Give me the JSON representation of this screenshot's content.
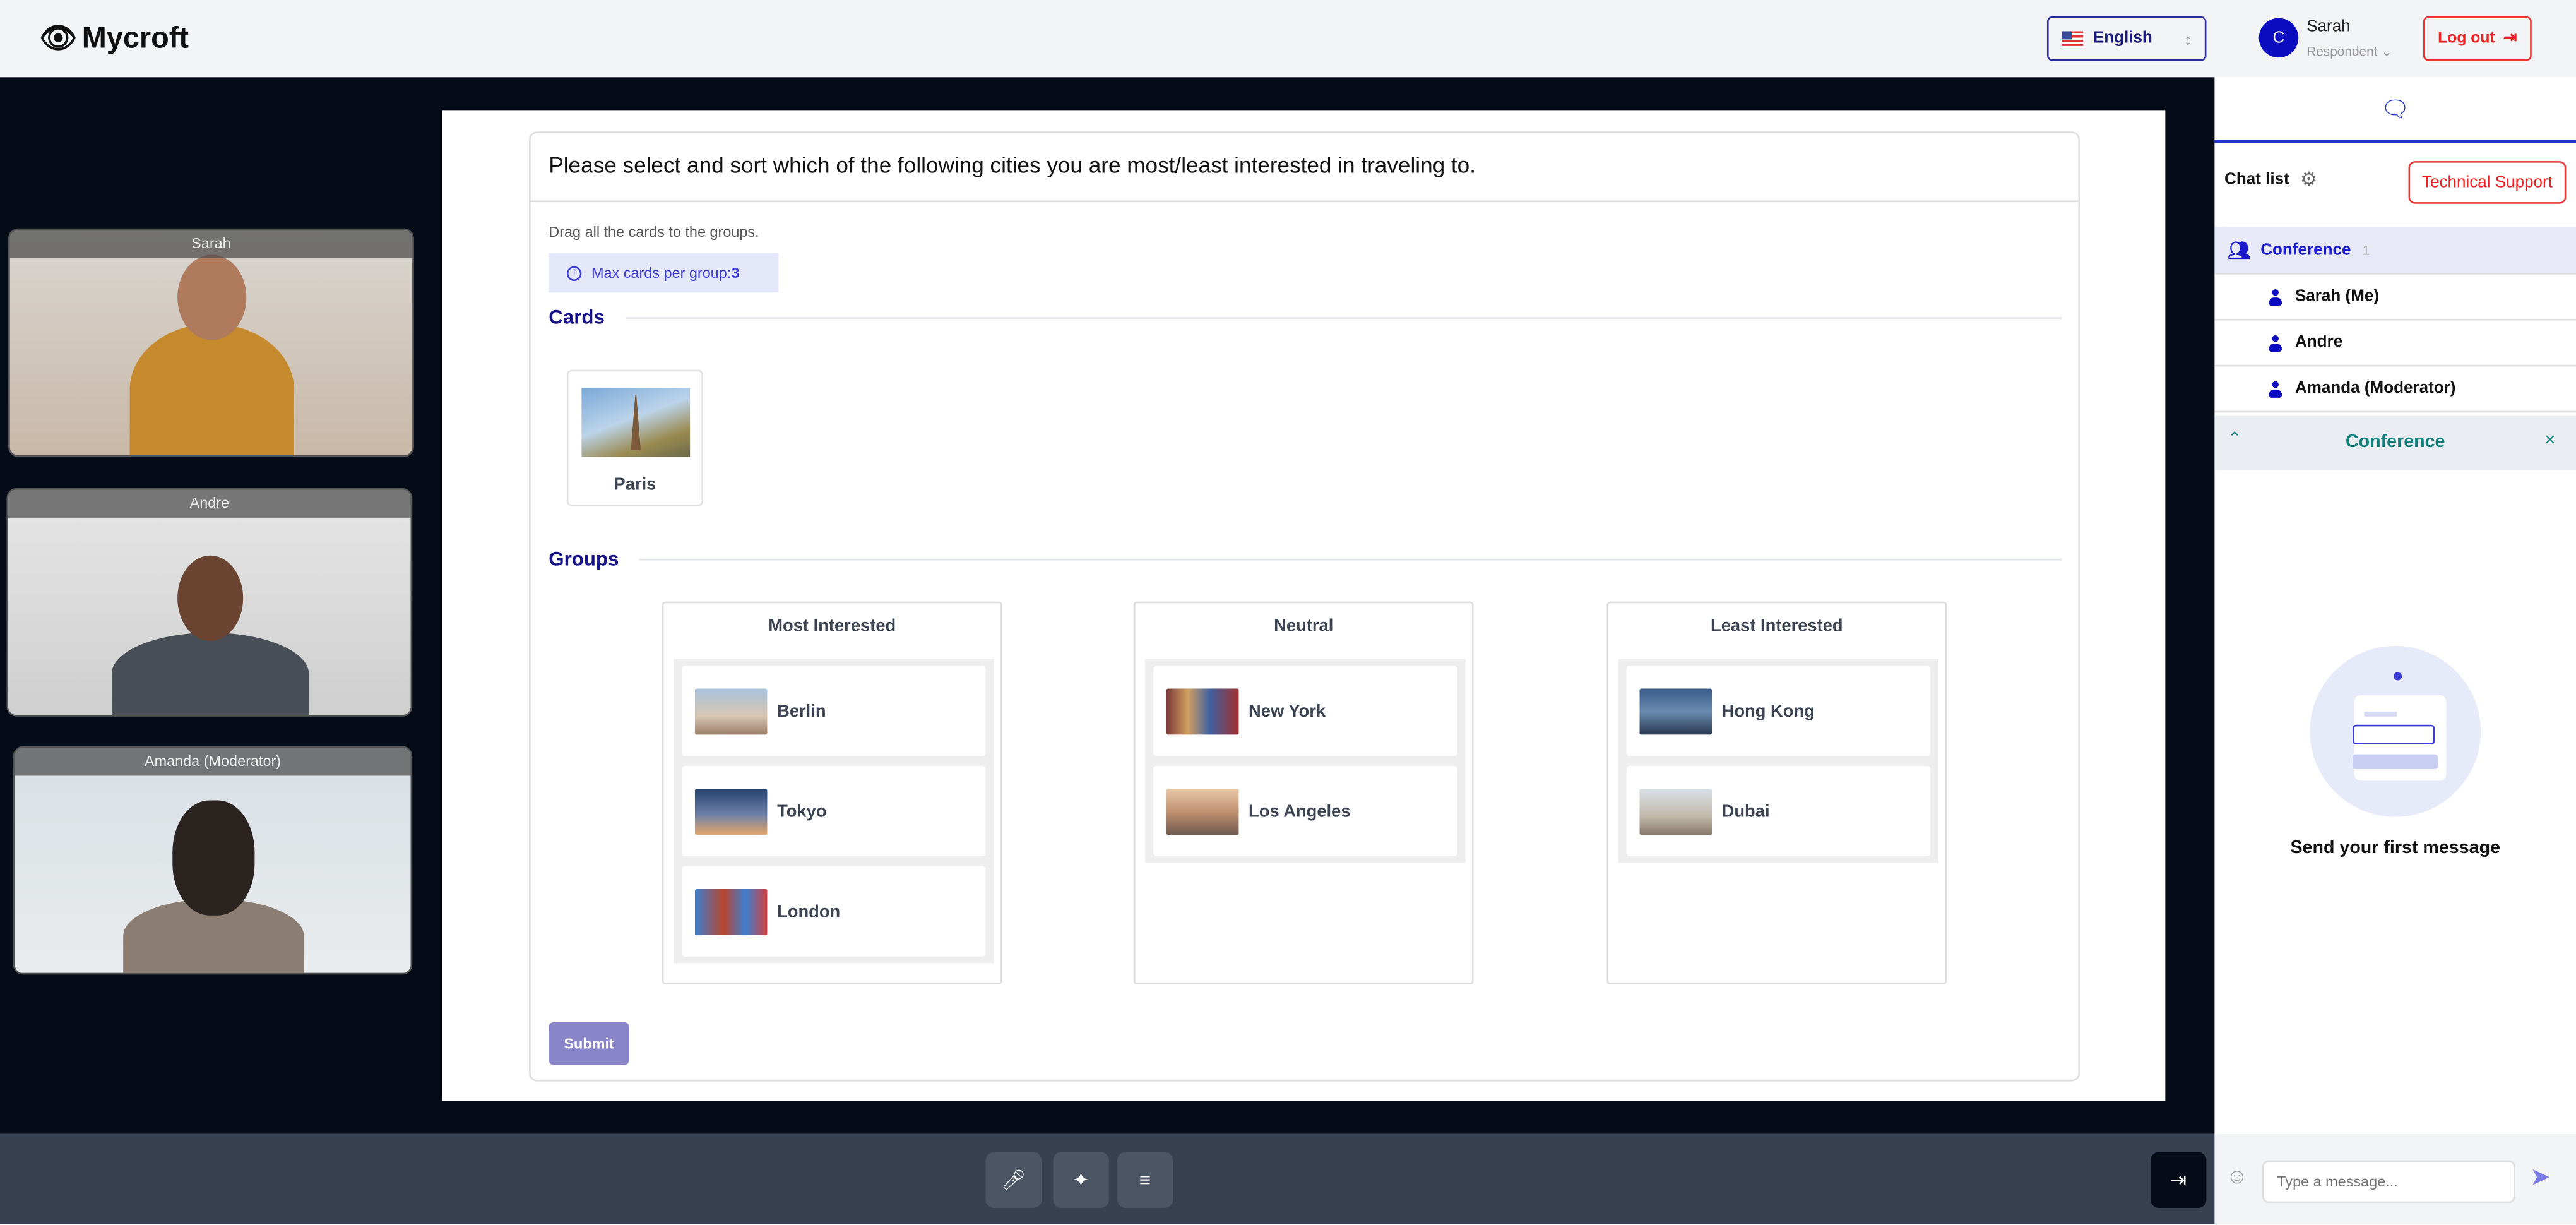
{
  "header": {
    "logo": "Mycroft",
    "language": "English",
    "user_initial": "C",
    "user_name": "Sarah",
    "user_role": "Respondent",
    "logout": "Log out"
  },
  "videos": [
    {
      "name": "Sarah"
    },
    {
      "name": "Andre"
    },
    {
      "name": "Amanda (Moderator)"
    }
  ],
  "question": {
    "title": "Please select and sort which of the following cities you are most/least interested in traveling to.",
    "hint": "Drag all the cards to the groups.",
    "max_label": "Max cards per group:",
    "max_value": "3",
    "cards_heading": "Cards",
    "cards": [
      {
        "name": "Paris"
      }
    ],
    "groups_heading": "Groups",
    "groups": [
      {
        "title": "Most Interested",
        "items": [
          {
            "name": "Berlin"
          },
          {
            "name": "Tokyo"
          },
          {
            "name": "London"
          }
        ]
      },
      {
        "title": "Neutral",
        "items": [
          {
            "name": "New York"
          },
          {
            "name": "Los Angeles"
          }
        ]
      },
      {
        "title": "Least Interested",
        "items": [
          {
            "name": "Hong Kong"
          },
          {
            "name": "Dubai"
          }
        ]
      }
    ],
    "submit": "Submit"
  },
  "chat": {
    "list_label": "Chat list",
    "support": "Technical Support",
    "conference": "Conference",
    "conference_count": "1",
    "members": [
      {
        "name": "Sarah (Me)"
      },
      {
        "name": "Andre"
      },
      {
        "name": "Amanda (Moderator)"
      }
    ],
    "active_title": "Conference",
    "empty_text": "Send your first message",
    "input_placeholder": "Type a message..."
  },
  "colors": {
    "accent": "#0b0bbf",
    "danger": "#e22222",
    "submit": "#8a84c9",
    "teal": "#11807a"
  }
}
